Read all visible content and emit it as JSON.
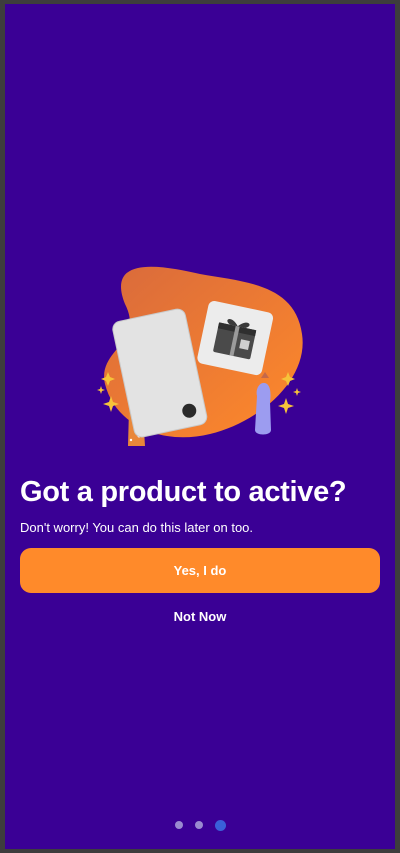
{
  "onboarding": {
    "title": "Got a product to active?",
    "subtitle": "Don't worry! You can do this later on too.",
    "primary_label": "Yes, I do",
    "secondary_label": "Not Now"
  },
  "pagination": {
    "total": 3,
    "active_index": 2
  },
  "colors": {
    "background": "#3a0095",
    "accent": "#ff8a2a",
    "dot_inactive": "#9a8ad0",
    "dot_active": "#3a60d9"
  },
  "illustration": {
    "icons": [
      "blob-shape",
      "blank-card",
      "gift-card",
      "sparkle-icon",
      "hand-left",
      "hand-right"
    ]
  }
}
